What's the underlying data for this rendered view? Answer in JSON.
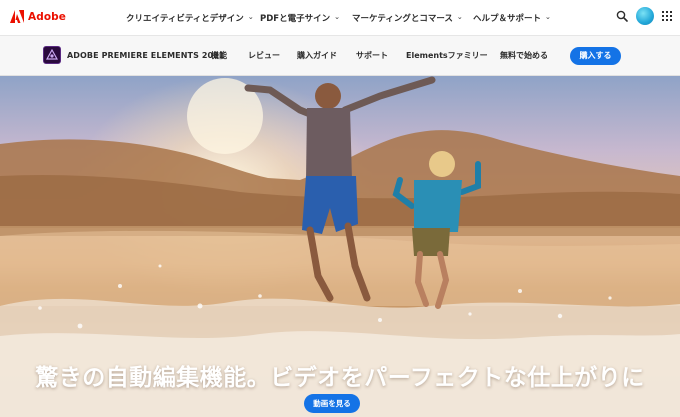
{
  "global_nav": {
    "brand": "Adobe",
    "menu": [
      {
        "label": "クリエイティビティとデザイン"
      },
      {
        "label": "PDFと電子サイン"
      },
      {
        "label": "マーケティングとコマース"
      },
      {
        "label": "ヘルプ＆サポート"
      }
    ],
    "icons": {
      "search": "search-icon",
      "avatar": "user-avatar",
      "apps": "app-switcher-icon"
    },
    "brand_color": "#eb1000"
  },
  "product_nav": {
    "product_name": "ADOBE PREMIERE ELEMENTS 2021",
    "items": [
      {
        "label": "機能"
      },
      {
        "label": "レビュー"
      },
      {
        "label": "購入ガイド"
      },
      {
        "label": "サポート"
      },
      {
        "label": "Elementsファミリー"
      },
      {
        "label": "無料で始める"
      }
    ],
    "buy_label": "購入する",
    "accent": "#1473e6"
  },
  "hero": {
    "headline": "驚きの自動編集機能。ビデオをパーフェクトな仕上がりに",
    "cta_label": "動画を見る"
  }
}
